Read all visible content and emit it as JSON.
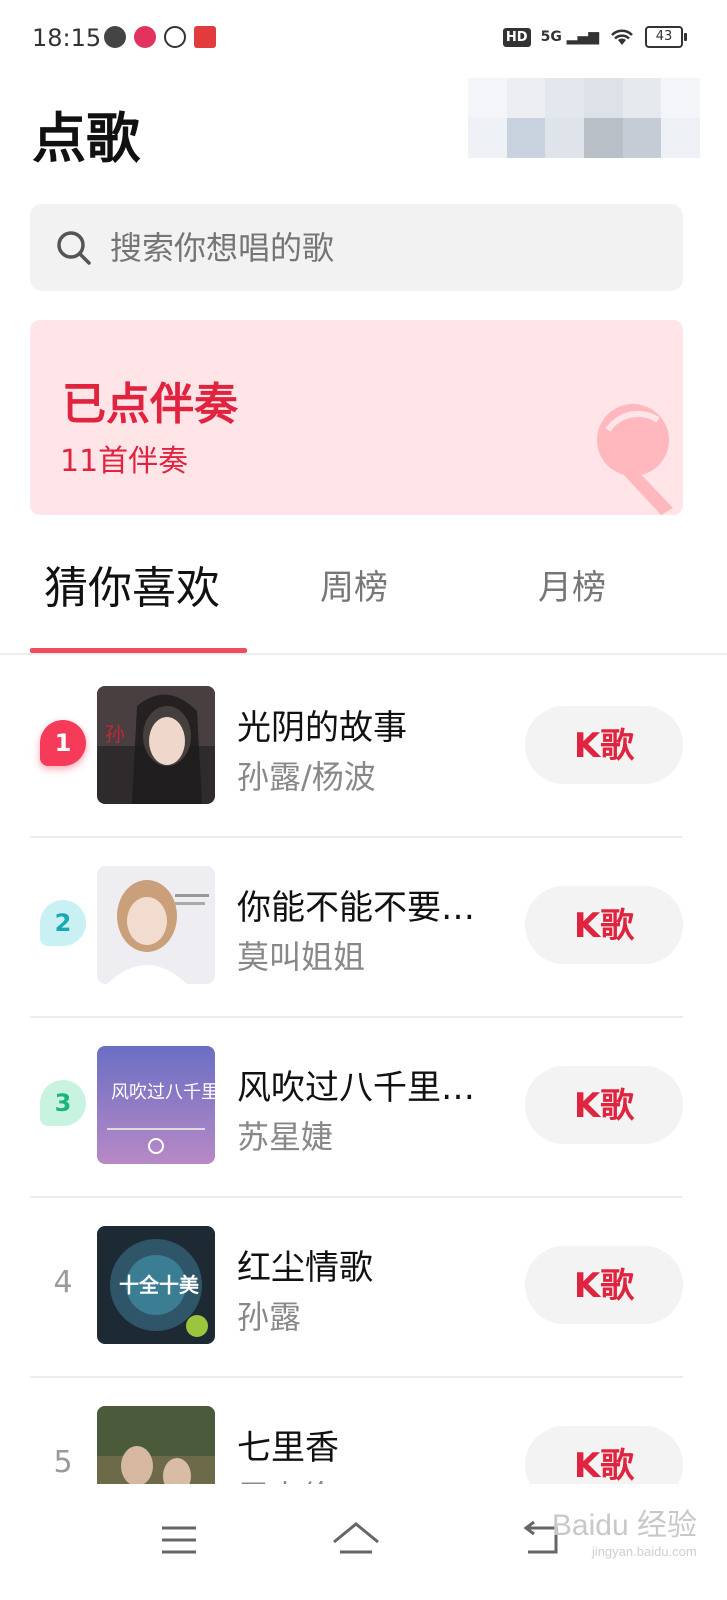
{
  "status_bar": {
    "time": "18:15",
    "network": "5G",
    "hd_label": "HD",
    "battery": "43"
  },
  "page": {
    "title": "点歌"
  },
  "search": {
    "placeholder": "搜索你想唱的歌"
  },
  "banner": {
    "title": "已点伴奏",
    "subtitle": "11首伴奏",
    "background": "#ffe5e7",
    "accent": "#e0243f"
  },
  "tabs": [
    {
      "label": "猜你喜欢",
      "active": true
    },
    {
      "label": "周榜",
      "active": false
    },
    {
      "label": "月榜",
      "active": false
    }
  ],
  "songs": [
    {
      "rank": "1",
      "title": "光阴的故事",
      "singer": "孙露/杨波",
      "action": "K歌"
    },
    {
      "rank": "2",
      "title": "你能不能不要…",
      "singer": "莫叫姐姐",
      "action": "K歌"
    },
    {
      "rank": "3",
      "title": "风吹过八千里…",
      "singer": "苏星婕",
      "action": "K歌"
    },
    {
      "rank": "4",
      "title": "红尘情歌",
      "singer": "孙露",
      "action": "K歌"
    },
    {
      "rank": "5",
      "title": "七里香",
      "singer": "周杰伦",
      "action": "K歌"
    }
  ],
  "album_art_text": {
    "cover3": "风吹过八千里",
    "cover4": "十全十美"
  },
  "watermark": {
    "text": "Baidu 经验",
    "sub": "jingyan.baidu.com"
  },
  "colors": {
    "accent_red": "#e0243f",
    "tab_indicator": "#f04c5b",
    "rank1": "#f53a5a",
    "rank2": "#1aa9b4",
    "rank3": "#1bb57c"
  }
}
